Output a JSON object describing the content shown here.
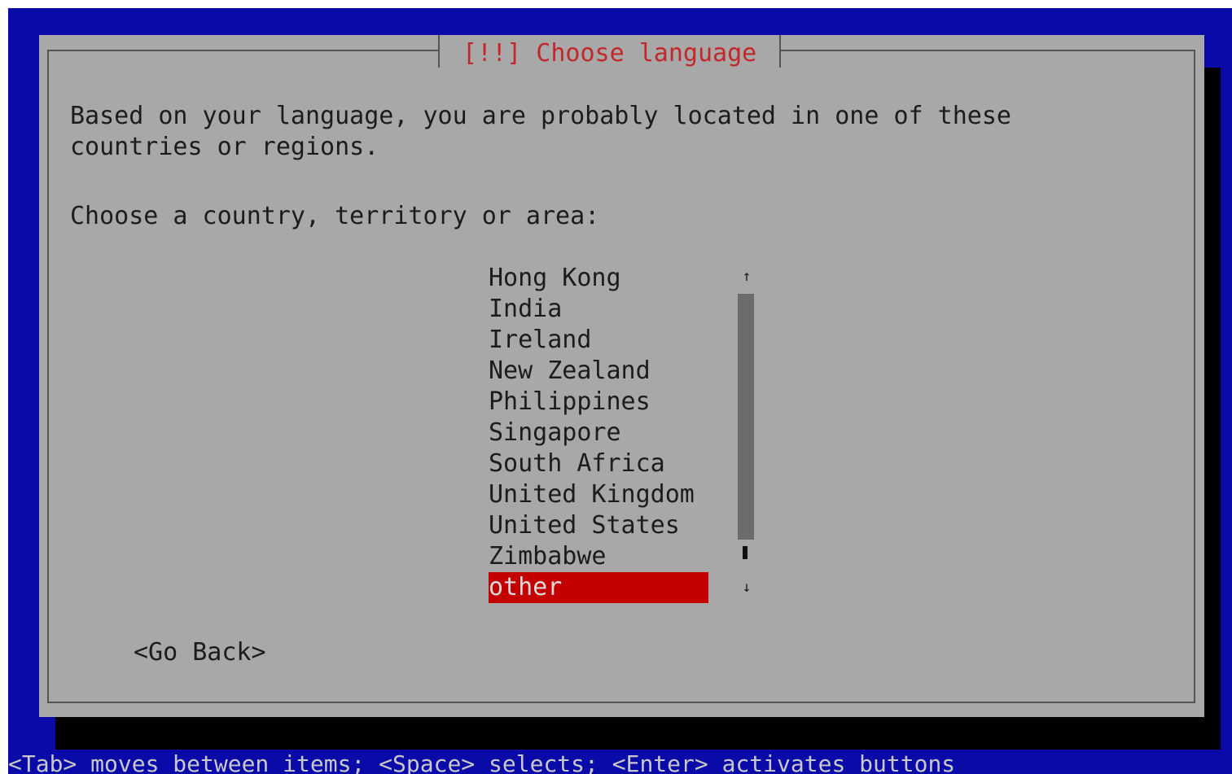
{
  "dialog": {
    "title": "[!!] Choose language",
    "prompt_line1": "Based on your language, you are probably located in one of these",
    "prompt_line2": "countries or regions.",
    "question": "Choose a country, territory or area:",
    "options": [
      "Hong Kong",
      "India",
      "Ireland",
      "New Zealand",
      "Philippines",
      "Singapore",
      "South Africa",
      "United Kingdom",
      "United States",
      "Zimbabwe",
      "other"
    ],
    "selected_option": "other",
    "go_back_label": "<Go Back>"
  },
  "scrollbar": {
    "up_icon": "↑",
    "down_icon": "↓"
  },
  "footer": {
    "hint": "<Tab> moves between items; <Space> selects; <Enter> activates buttons"
  },
  "colors": {
    "background": "#0a0aa8",
    "dialog": "#a8a8a8",
    "title": "#c2282a",
    "selection": "#c40000"
  }
}
